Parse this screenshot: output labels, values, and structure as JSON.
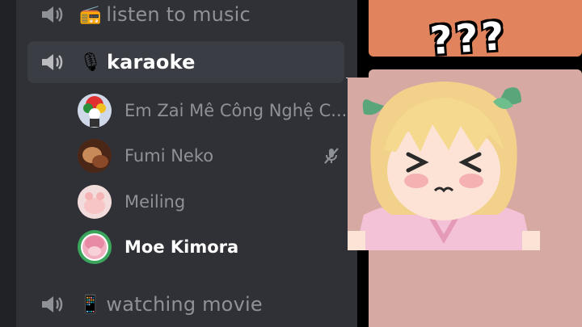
{
  "channels": [
    {
      "emoji": "📻",
      "name": "listen to music"
    },
    {
      "emoji": "🎙",
      "name": "karaoke"
    },
    {
      "emoji": "📱",
      "name": "watching movie"
    }
  ],
  "members": [
    {
      "name": "Em Zai Mê Công Nghệ C...",
      "avatar_color": "#e03030"
    },
    {
      "name": "Fumi Neko",
      "avatar_color": "#6a3a22"
    },
    {
      "name": "Meiling",
      "avatar_color": "#f2c9c9"
    },
    {
      "name": "Moe Kimora",
      "avatar_color": "#f0b0c0",
      "speaking_ring": "#3ba55c"
    }
  ],
  "overlay": {
    "question_marks": "???"
  },
  "colors": {
    "sidebar_bg": "#2f3136",
    "active_bg": "#3a3d43",
    "muted_text": "#8e9297",
    "panel_orange": "#e1845d",
    "panel_pink": "#d7a9a3"
  }
}
